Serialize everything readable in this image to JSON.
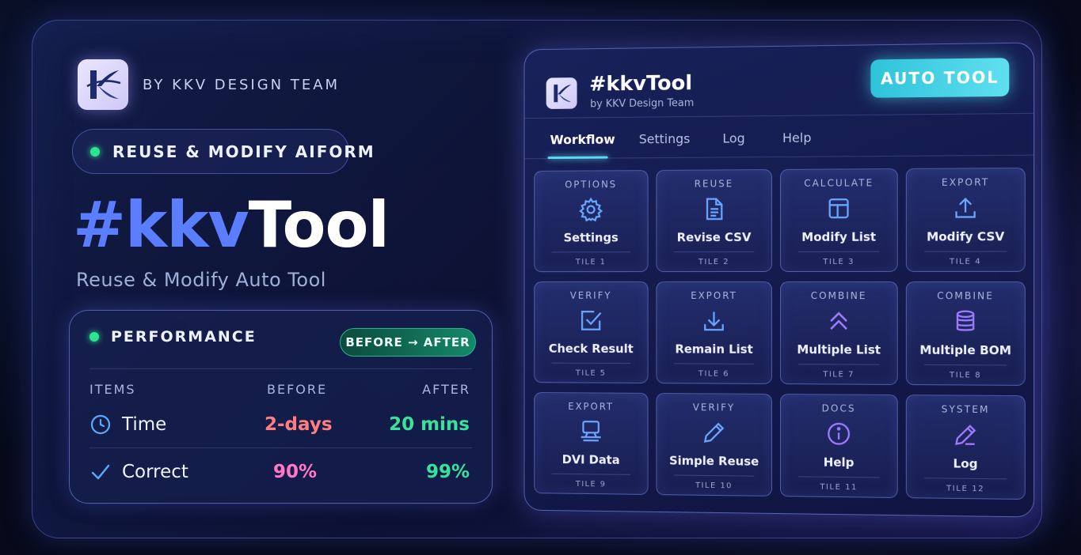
{
  "brand": {
    "byline": "BY KKV DESIGN TEAM",
    "logo": "kkv-logo"
  },
  "tag_pill": {
    "label": "REUSE & MODIFY AIFORM",
    "status_color": "#2ee58f"
  },
  "hero": {
    "title_hash_part": "#kkv",
    "title_word_part": "Tool",
    "subtitle": "Reuse & Modify Auto Tool"
  },
  "performance": {
    "title": "PERFORMANCE",
    "badge": "BEFORE → AFTER",
    "columns": {
      "items": "ITEMS",
      "before": "BEFORE",
      "after": "AFTER"
    },
    "rows": [
      {
        "icon": "clock-icon",
        "label": "Time",
        "before": "2-days",
        "after": "20 mins",
        "before_color": "#ff7f7f",
        "after_color": "#35e39a"
      },
      {
        "icon": "checkmark-icon",
        "label": "Correct",
        "before": "90%",
        "after": "99%",
        "before_color": "#ff79c6",
        "after_color": "#35e39a"
      }
    ]
  },
  "panel": {
    "title": "#kkvTool",
    "subtitle": "by KKV Design Team",
    "button": "AUTO TOOL",
    "tabs": [
      {
        "label": "Workflow",
        "active": true
      },
      {
        "label": "Settings",
        "active": false
      },
      {
        "label": "Log",
        "active": false
      },
      {
        "label": "Help",
        "active": false
      }
    ],
    "tiles": [
      {
        "category": "OPTIONS",
        "name": "Settings",
        "number": "TILE 1",
        "icon": "gear-icon"
      },
      {
        "category": "REUSE",
        "name": "Revise CSV",
        "number": "TILE 2",
        "icon": "document-icon"
      },
      {
        "category": "CALCULATE",
        "name": "Modify List",
        "number": "TILE 3",
        "icon": "layout-icon"
      },
      {
        "category": "EXPORT",
        "name": "Modify CSV",
        "number": "TILE 4",
        "icon": "upload-icon"
      },
      {
        "category": "VERIFY",
        "name": "Check Result",
        "number": "TILE 5",
        "icon": "checkbox-icon"
      },
      {
        "category": "EXPORT",
        "name": "Remain List",
        "number": "TILE 6",
        "icon": "download-icon"
      },
      {
        "category": "COMBINE",
        "name": "Multiple List",
        "number": "TILE 7",
        "icon": "double-chevron-up-icon"
      },
      {
        "category": "COMBINE",
        "name": "Multiple BOM",
        "number": "TILE 8",
        "icon": "database-icon"
      },
      {
        "category": "EXPORT",
        "name": "DVI Data",
        "number": "TILE 9",
        "icon": "monitor-icon"
      },
      {
        "category": "VERIFY",
        "name": "Simple Reuse",
        "number": "TILE 10",
        "icon": "pen-icon"
      },
      {
        "category": "DOCS",
        "name": "Help",
        "number": "TILE 11",
        "icon": "info-icon"
      },
      {
        "category": "SYSTEM",
        "name": "Log",
        "number": "TILE 12",
        "icon": "edit-icon"
      }
    ]
  },
  "colors": {
    "accent_blue": "#5b7dff",
    "accent_cyan": "#5fe0f0",
    "success_green": "#2ee58f"
  }
}
